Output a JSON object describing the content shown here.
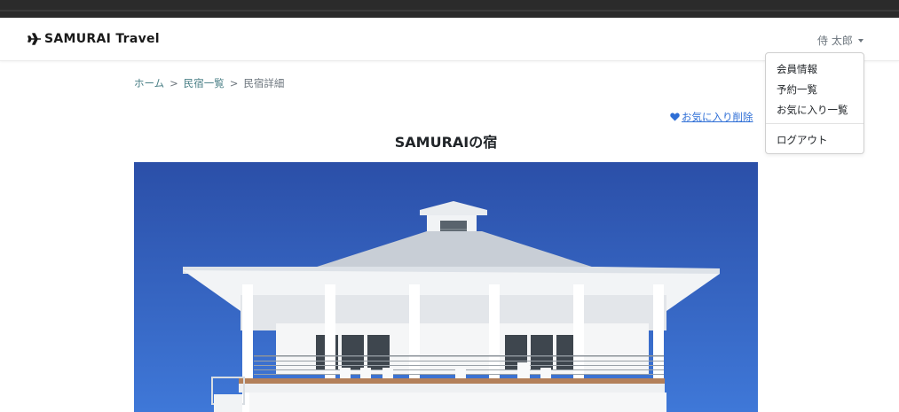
{
  "brand": {
    "name": "SAMURAI Travel",
    "icon": "airplane-icon"
  },
  "user_menu": {
    "user_name": "侍 太郎",
    "items": [
      {
        "label": "会員情報"
      },
      {
        "label": "予約一覧"
      },
      {
        "label": "お気に入り一覧"
      }
    ],
    "logout_label": "ログアウト"
  },
  "breadcrumb": {
    "items": [
      {
        "label": "ホーム"
      },
      {
        "label": "民宿一覧"
      }
    ],
    "separator": ">",
    "current": "民宿詳細"
  },
  "favorite": {
    "icon": "heart-icon",
    "label": "お気に入り削除",
    "color": "#2f6fd6"
  },
  "house": {
    "name": "SAMURAIの宿"
  },
  "colors": {
    "link": "#4a7f86",
    "sky": "#2d56b5",
    "topbar": "#2b2b2b"
  }
}
